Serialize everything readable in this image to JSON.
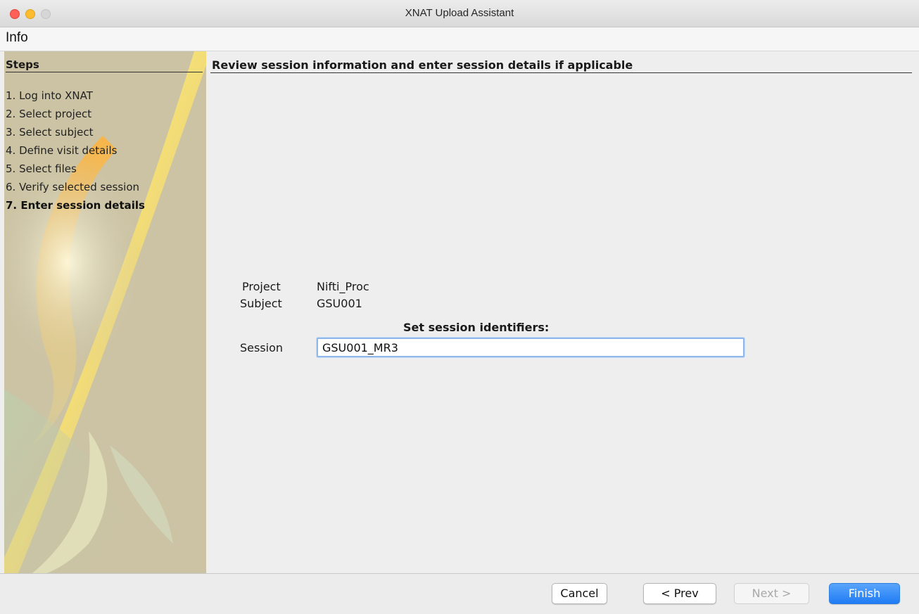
{
  "window": {
    "title": "XNAT Upload Assistant"
  },
  "menubar": {
    "items": [
      {
        "label": "Info"
      }
    ]
  },
  "sidebar": {
    "title": "Steps",
    "steps": [
      {
        "label": "1. Log into XNAT",
        "active": false
      },
      {
        "label": "2. Select project",
        "active": false
      },
      {
        "label": "3. Select subject",
        "active": false
      },
      {
        "label": "4. Define visit details",
        "active": false
      },
      {
        "label": "5. Select files",
        "active": false
      },
      {
        "label": "6. Verify selected session",
        "active": false
      },
      {
        "label": "7. Enter session details",
        "active": true
      }
    ]
  },
  "panel": {
    "heading": "Review session information and enter session details if applicable",
    "project": {
      "label": "Project",
      "value": "Nifti_Proc"
    },
    "subject": {
      "label": "Subject",
      "value": "GSU001"
    },
    "set_identifiers": "Set session identifiers:",
    "session": {
      "label": "Session",
      "value": "GSU001_MR3"
    }
  },
  "buttons": {
    "cancel": "Cancel",
    "prev": "< Prev",
    "next": "Next >",
    "finish": "Finish"
  },
  "colors": {
    "accent": "#1f7cf4",
    "sidebar_bg": "#c9c0a1",
    "sidebar_highlight": "#fff27a"
  }
}
